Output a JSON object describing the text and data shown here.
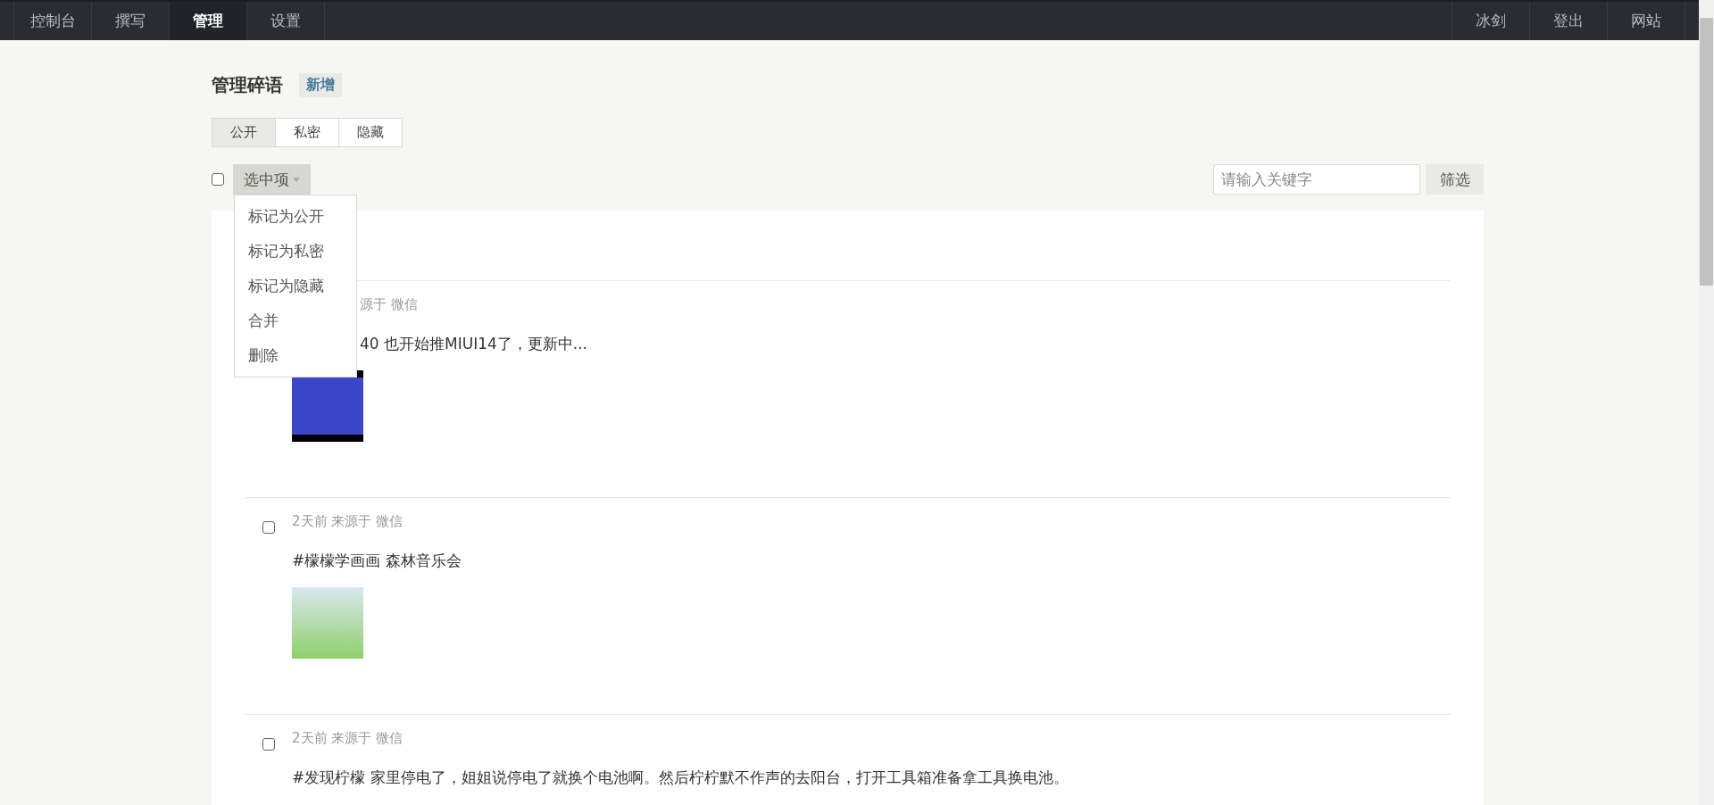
{
  "nav": {
    "left": [
      {
        "label": "控制台",
        "selected": false
      },
      {
        "label": "撰写",
        "selected": false
      },
      {
        "label": "管理",
        "selected": true
      },
      {
        "label": "设置",
        "selected": false
      }
    ],
    "right": [
      "冰剑",
      "登出",
      "网站"
    ]
  },
  "page": {
    "title": "管理碎语",
    "add_button": "新增"
  },
  "tabs": [
    {
      "label": "公开",
      "selected": true
    },
    {
      "label": "私密",
      "selected": false
    },
    {
      "label": "隐藏",
      "selected": false
    }
  ],
  "toolbar": {
    "select_all_checked": false,
    "selection_button": "选中项",
    "search": {
      "placeholder": "请输入关键字"
    },
    "filter_button": "筛选"
  },
  "selection_menu": {
    "open": true,
    "items": [
      "标记为公开",
      "标记为私密",
      "标记为隐藏",
      "合并",
      "删除"
    ]
  },
  "posts": [
    {
      "kind": "covered",
      "meta": "源于 微信",
      "text": "40 也开始推MIUI14了，更新中...",
      "photo": true
    },
    {
      "kind": "normal",
      "checked": false,
      "meta": "2天前 来源于 微信",
      "text": "#檬檬学画画 森林音乐会",
      "photo": true
    },
    {
      "kind": "normal",
      "checked": false,
      "meta": "2天前 来源于 微信",
      "text": "#发现柠檬 家里停电了，姐姐说停电了就换个电池啊。然后柠柠默不作声的去阳台，打开工具箱准备拿工具换电池。"
    }
  ]
}
